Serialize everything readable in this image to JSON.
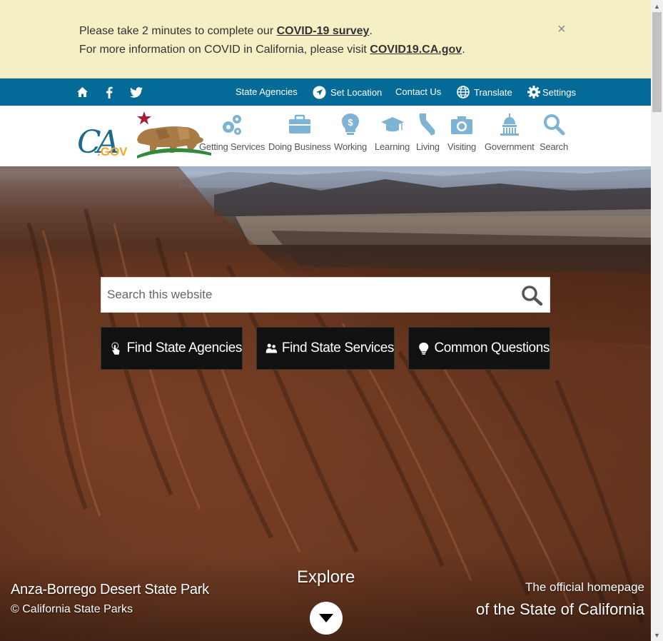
{
  "alert": {
    "line1_prefix": "Please take 2 minutes to complete our ",
    "line1_link": "COVID-19 survey",
    "line1_suffix": ".",
    "line2_prefix": "For more information on COVID in California, please visit ",
    "line2_link": "COVID19.CA.gov",
    "line2_suffix": ".",
    "close": "×"
  },
  "utility": {
    "icons": [
      "home-icon",
      "facebook-icon",
      "twitter-icon"
    ],
    "state_agencies": "State Agencies",
    "set_location": "Set Location",
    "contact_us": "Contact Us",
    "translate": "Translate",
    "settings": "Settings",
    "bg_color": "#046b99"
  },
  "logo": {
    "text": "CA.GOV"
  },
  "nav": {
    "getting_services": "Getting Services",
    "doing_business": "Doing Business",
    "working": "Working",
    "learning": "Learning",
    "living": "Living",
    "visiting": "Visiting",
    "government": "Government",
    "search": "Search",
    "icon_color": "#7fb3d3"
  },
  "hero": {
    "search_placeholder": "Search this website",
    "buttons": {
      "agencies": "Find State Agencies",
      "services": "Find State Services",
      "questions": "Common Questions"
    },
    "caption_title": "Anza-Borrego Desert State Park",
    "caption_credit": "© California State Parks",
    "explore": "Explore",
    "official_line1": "The official homepage",
    "official_line2": "of the State of California"
  }
}
